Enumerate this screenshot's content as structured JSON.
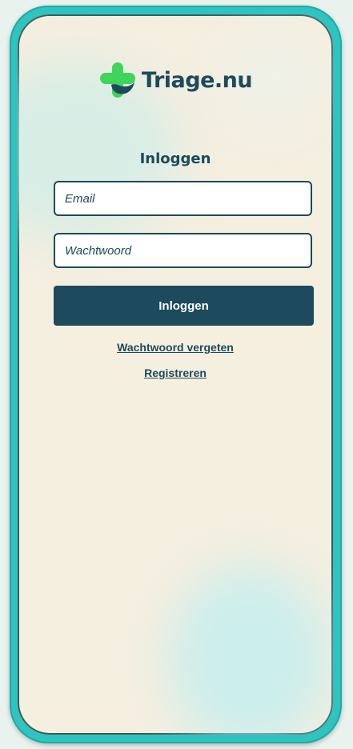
{
  "brand": {
    "name": "Triage.nu",
    "colors": {
      "primary": "#1d4a5c",
      "accent": "#2ec4bf",
      "logo_green": "#3fd45a",
      "background": "#f5efe0"
    }
  },
  "login": {
    "title": "Inloggen",
    "email_placeholder": "Email",
    "email_value": "",
    "password_placeholder": "Wachtwoord",
    "password_value": "",
    "submit_label": "Inloggen",
    "forgot_password_link": "Wachtwoord vergeten",
    "register_link": "Registreren"
  },
  "icons": {
    "logo": "green-cross-with-wave-icon"
  }
}
